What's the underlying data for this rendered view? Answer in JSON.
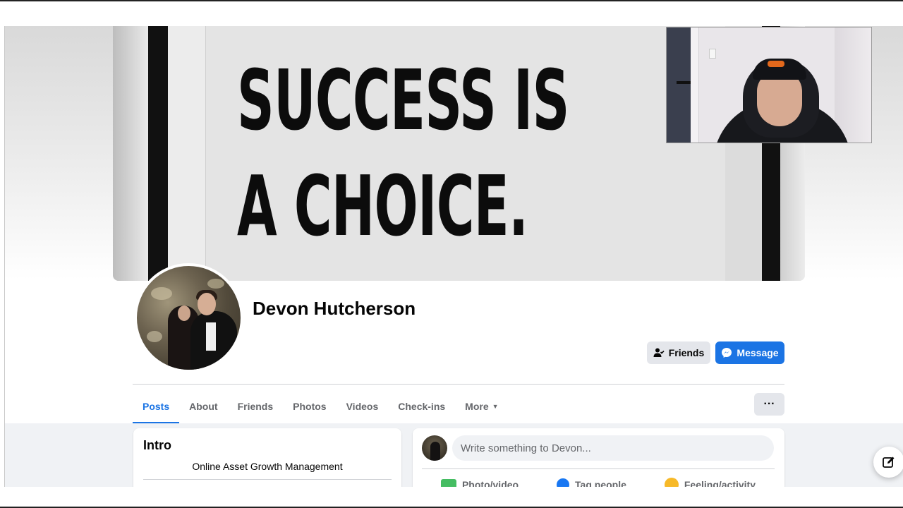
{
  "cover": {
    "line1": "SUCCESS IS",
    "line2": "A CHOICE."
  },
  "profile": {
    "name": "Devon Hutcherson"
  },
  "actions": {
    "friends_label": "Friends",
    "message_label": "Message",
    "more_label": "···"
  },
  "tabs": [
    {
      "label": "Posts",
      "active": true
    },
    {
      "label": "About"
    },
    {
      "label": "Friends"
    },
    {
      "label": "Photos"
    },
    {
      "label": "Videos"
    },
    {
      "label": "Check-ins"
    },
    {
      "label": "More"
    }
  ],
  "intro": {
    "title": "Intro",
    "bio": "Online Asset Growth Management"
  },
  "composer": {
    "placeholder": "Write something to Devon...",
    "actions": [
      {
        "label": "Photo/video",
        "icon": "photo-icon"
      },
      {
        "label": "Tag people",
        "icon": "tag-people-icon"
      },
      {
        "label": "Feeling/activity",
        "icon": "feeling-icon"
      }
    ]
  },
  "colors": {
    "accent": "#1b74e4",
    "button_gray": "#e4e6eb",
    "page_bg": "#f0f2f5"
  }
}
